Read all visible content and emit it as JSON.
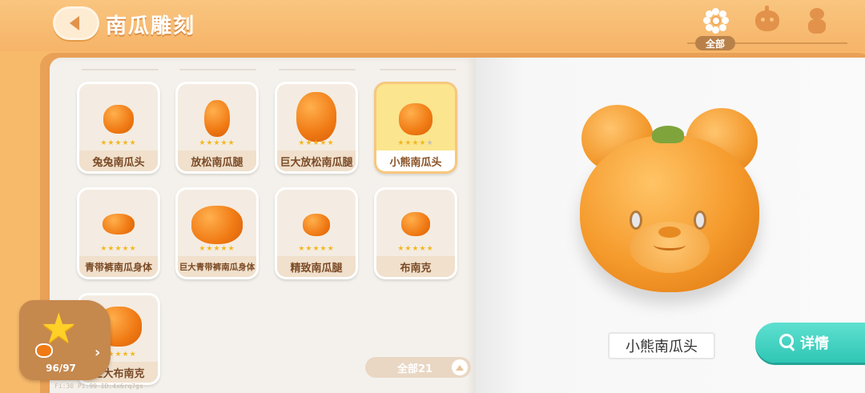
{
  "header": {
    "title": "南瓜雕刻",
    "filters": [
      {
        "label": "全部",
        "icon": "flower-icon",
        "active": true
      },
      {
        "label": "",
        "icon": "pumpkin-head-icon",
        "active": false
      },
      {
        "label": "",
        "icon": "pumpkin-body-icon",
        "active": false
      }
    ]
  },
  "items": [
    {
      "name": "兔兔南瓜头",
      "stars": 5,
      "selected": false
    },
    {
      "name": "放松南瓜腿",
      "stars": 5,
      "selected": false
    },
    {
      "name": "巨大放松南瓜腿",
      "stars": 5,
      "selected": false
    },
    {
      "name": "小熊南瓜头",
      "stars": 4,
      "selected": true
    },
    {
      "name": "青带裤南瓜身体",
      "stars": 5,
      "selected": false
    },
    {
      "name": "巨大青带裤南瓜身体",
      "stars": 5,
      "selected": false
    },
    {
      "name": "精致南瓜腿",
      "stars": 5,
      "selected": false
    },
    {
      "name": "布南克",
      "stars": 5,
      "selected": false
    },
    {
      "name": "巨大布南克",
      "stars": 5,
      "selected": false
    }
  ],
  "progress": {
    "count": "96/97"
  },
  "sort": {
    "label": "全部21"
  },
  "preview": {
    "name": "小熊南瓜头"
  },
  "detail_button": {
    "label": "详情"
  },
  "debug": {
    "text": "Fi:30   Pi:99   ID:4x6rq7gs"
  },
  "colors": {
    "accent": "#f7b96a",
    "selected": "#fbe58e",
    "detail": "#2fc6b5",
    "star": "#f2b824"
  }
}
